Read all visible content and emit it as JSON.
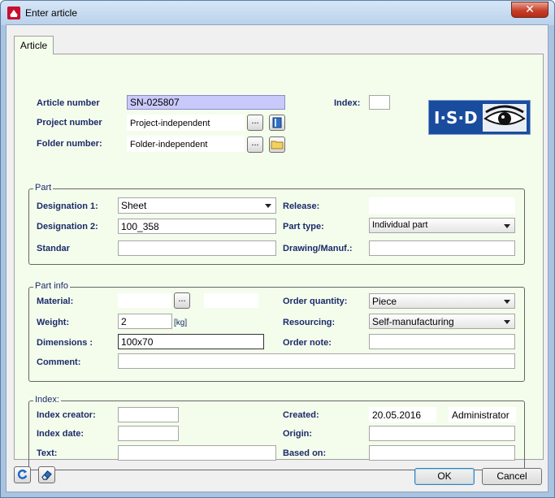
{
  "window": {
    "title": "Enter article",
    "close_label": "✕"
  },
  "tab": {
    "label": "Article"
  },
  "header": {
    "article_number_label": "Article number",
    "article_number_value": "SN-025807",
    "project_number_label": "Project number",
    "project_number_value": "Project-independent",
    "folder_number_label": "Folder number:",
    "folder_number_value": "Folder-independent",
    "index_label": "Index:",
    "index_value": "",
    "browse_label": "...",
    "logo_text": "I·S·D"
  },
  "part": {
    "title": "Part",
    "designation1_label": "Designation 1:",
    "designation1_value": "Sheet",
    "designation2_label": "Designation 2:",
    "designation2_value": "100_358",
    "standard_label": "Standar",
    "standard_value": "",
    "release_label": "Release:",
    "release_value": "",
    "part_type_label": "Part type:",
    "part_type_value": "Individual part",
    "drawing_label": "Drawing/Manuf.:",
    "drawing_value": ""
  },
  "part_info": {
    "title": "Part info",
    "material_label": "Material:",
    "material_value": "",
    "material_extra": "",
    "browse_label": "...",
    "weight_label": "Weight:",
    "weight_value": "2",
    "weight_unit": "[kg]",
    "dimensions_label": "Dimensions :",
    "dimensions_value": "100x70",
    "comment_label": "Comment:",
    "comment_value": "",
    "order_quantity_label": "Order quantity:",
    "order_quantity_value": "Piece",
    "resourcing_label": "Resourcing:",
    "resourcing_value": "Self-manufacturing",
    "order_note_label": "Order note:",
    "order_note_value": ""
  },
  "index_group": {
    "title": "Index:",
    "creator_label": "Index creator:",
    "creator_value": "",
    "date_label": "Index date:",
    "date_value": "",
    "text_label": "Text:",
    "text_value": "",
    "created_label": "Created:",
    "created_date": "20.05.2016",
    "created_by": "Administrator",
    "origin_label": "Origin:",
    "origin_value": "",
    "based_on_label": "Based on:",
    "based_on_value": ""
  },
  "footer": {
    "ok_label": "OK",
    "cancel_label": "Cancel"
  },
  "colors": {
    "panel_bg": "#f4fdec",
    "label_text": "#1c2a6a",
    "highlight_field": "#c9c9fb",
    "logo_blue": "#1a4c9e",
    "close_red": "#c7402a"
  }
}
